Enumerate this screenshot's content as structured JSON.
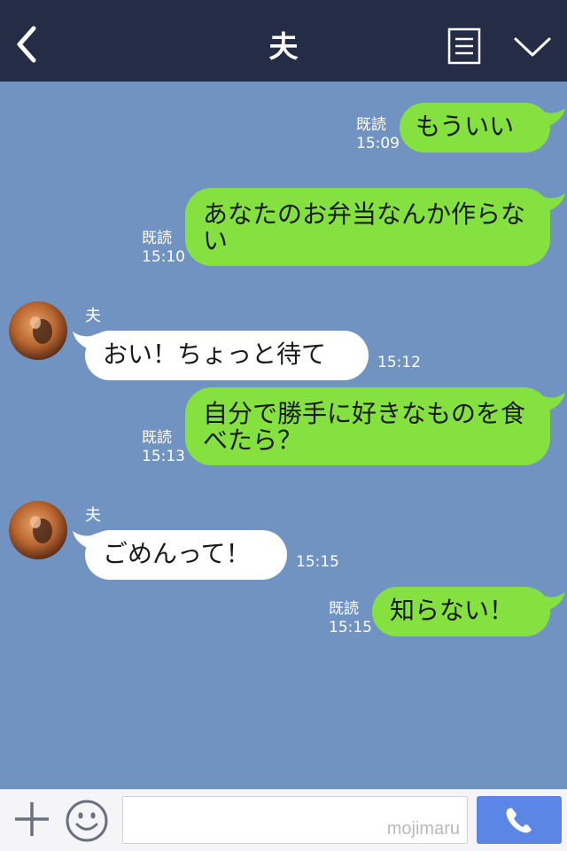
{
  "header": {
    "title": "夫"
  },
  "messages": [
    {
      "side": "right",
      "text": "もういい",
      "read_label": "既読",
      "time": "15:09"
    },
    {
      "side": "right",
      "text": "あなたのお弁当なんか作らない",
      "read_label": "既読",
      "time": "15:10"
    },
    {
      "side": "left",
      "sender": "夫",
      "text": "おい！ちょっと待て",
      "time": "15:12"
    },
    {
      "side": "right",
      "text": "自分で勝手に好きなものを食べたら？",
      "read_label": "既読",
      "time": "15:13"
    },
    {
      "side": "left",
      "sender": "夫",
      "text": "ごめんって！",
      "time": "15:15"
    },
    {
      "side": "right",
      "text": "知らない！",
      "read_label": "既読",
      "time": "15:15"
    }
  ],
  "input": {
    "value": "",
    "watermark": "mojimaru"
  },
  "icons": {
    "back": "chevron-left-icon",
    "menu": "notes-icon",
    "collapse": "chevron-down-icon",
    "add": "plus-icon",
    "emoji": "smiley-icon",
    "call": "phone-icon"
  },
  "colors": {
    "header": "#242d45",
    "chat_background": "#7193c2",
    "my_bubble": "#84e13f",
    "their_bubble": "#ffffff",
    "call_button": "#5b86e6"
  }
}
